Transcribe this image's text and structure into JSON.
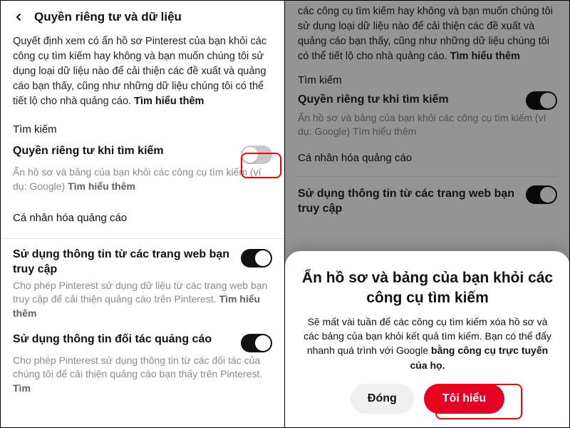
{
  "left": {
    "header_title": "Quyền riêng tư và dữ liệu",
    "intro_text": "Quyết định xem có ẩn hồ sơ Pinterest của bạn khỏi các công cụ tìm kiếm hay không và bạn muốn chúng tôi sử dụng loại dữ liệu nào để cải thiện các đề xuất và quảng cáo bạn thấy, cũng như những dữ liệu chúng tôi có thể tiết lộ cho nhà quảng cáo. ",
    "intro_link": "Tìm hiểu thêm",
    "search_section": "Tìm kiếm",
    "search_privacy_title": "Quyền riêng tư khi tìm kiếm",
    "search_privacy_desc": "Ẩn hồ sơ và bảng của bạn khỏi các công cụ tìm kiếm (ví dụ: Google) ",
    "search_privacy_link": "Tìm hiểu thêm",
    "personalize_section": "Cá nhân hóa quảng cáo",
    "use_web_title": "Sử dụng thông tin từ các trang web bạn truy cập",
    "use_web_desc": "Cho phép Pinterest sử dụng dữ liệu từ các trang web bạn truy cập để cải thiện quảng cáo trên Pinterest. ",
    "use_web_link": "Tìm hiểu thêm",
    "use_partner_title": "Sử dụng thông tin đối tác quảng cáo",
    "use_partner_desc": "Cho phép Pinterest sử dụng thông tin từ các đối tác của chúng tôi để cải thiện quảng cáo bạn thấy trên Pinterest. ",
    "use_partner_link": "Tìm"
  },
  "right": {
    "bg_intro": "các công cụ tìm kiếm hay không và bạn muốn chúng tôi sử dụng loại dữ liệu nào để cải thiện các đề xuất và quảng cáo bạn thấy, cũng như những dữ liệu chúng tôi có thể tiết lộ cho nhà quảng cáo. ",
    "bg_intro_link": "Tìm hiểu thêm",
    "bg_search_section": "Tìm kiếm",
    "bg_search_title": "Quyền riêng tư khi tìm kiếm",
    "bg_search_desc": "Ẩn hồ sơ và bảng của bạn khỏi các công cụ tìm kiếm (ví dụ: Google) Tìm hiểu thêm",
    "bg_personalize": "Cá nhân hóa quảng cáo",
    "bg_use_web_title": "Sử dụng thông tin từ các trang web bạn truy cập",
    "sheet_title": "Ẩn hồ sơ và bảng của bạn khỏi các công cụ tìm kiếm",
    "sheet_body_a": "Sẽ mất vài tuần để các công cụ tìm kiếm xóa hồ sơ và các bảng của bạn khỏi kết quả tìm kiếm. Bạn có thể đẩy nhanh quá trình với Google ",
    "sheet_body_b": "bằng công cụ trực tuyến của họ.",
    "btn_close": "Đóng",
    "btn_ok": "Tôi hiểu"
  }
}
